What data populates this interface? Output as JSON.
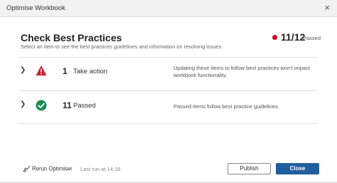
{
  "window": {
    "title": "Optimise Workbook",
    "close_glyph": "×"
  },
  "header": {
    "title": "Check Best Practices",
    "subtitle": "Select an item to see the best practices guidelines and information on resolving issues.",
    "score": "11/12",
    "score_label": "Passed",
    "score_dot_color": "#d0021b"
  },
  "rows": [
    {
      "icon": "warning-triangle-icon",
      "icon_color": "#c8202f",
      "count": "1",
      "label": "Take action",
      "description": "Updating these items to follow best practices won't impact workbook functionality."
    },
    {
      "icon": "check-circle-icon",
      "icon_color": "#1f8a55",
      "count": "11",
      "label": "Passed",
      "description": "Passed items follow best practice guidelines."
    }
  ],
  "footer": {
    "rerun_label": "Rerun Optimiser",
    "last_run": "Last run at 14:18",
    "publish_label": "Publish",
    "close_label": "Close",
    "accent": "#1f5f9e"
  }
}
